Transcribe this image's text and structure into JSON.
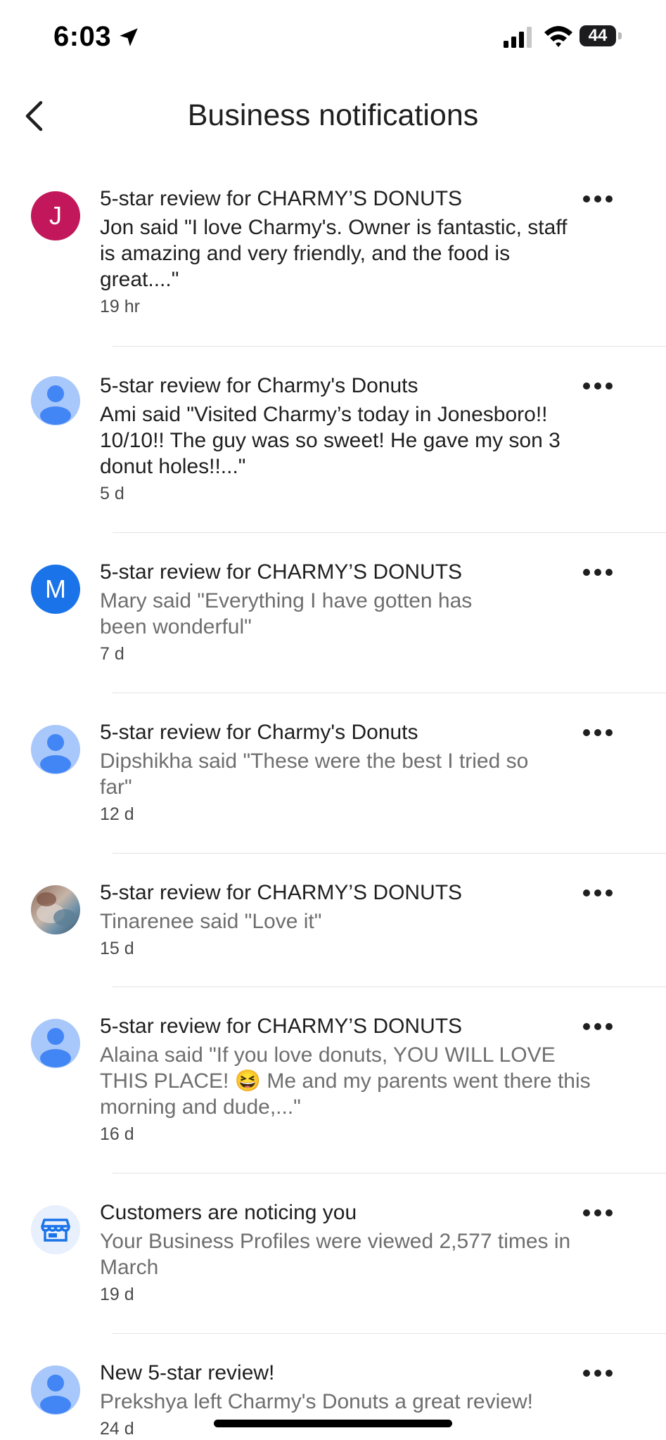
{
  "status_bar": {
    "time": "6:03",
    "battery": "44"
  },
  "header": {
    "title": "Business notifications",
    "back_icon": "chevron-left-icon"
  },
  "notifications": [
    {
      "avatar": "J",
      "avatar_color": "#c2185b",
      "title": "5-star review for CHARMY’S DONUTS",
      "body": "Jon said \"I love Charmy's. Owner is fantastic, staff is amazing and very friendly, and the food is great....\"",
      "time": "19 hr"
    },
    {
      "avatar_icon": "person-icon",
      "title": "5-star review for Charmy's Donuts",
      "body": "Ami said \"Visited Charmy’s today in Jonesboro!! 10/10!! The guy was so sweet! He gave my son 3 donut holes!!...\"",
      "time": "5 d"
    },
    {
      "avatar": "M",
      "avatar_color": "#1a73e8",
      "title": "5-star review for CHARMY’S DONUTS",
      "body": "Mary said \"Everything I have gotten has been wonderful\"",
      "time": "7 d"
    },
    {
      "avatar_icon": "person-icon",
      "title": "5-star review for Charmy's Donuts",
      "body": "Dipshikha said \"These were the best I tried so far\"",
      "time": "12 d"
    },
    {
      "avatar_icon": "profile-photo",
      "title": "5-star review for CHARMY’S DONUTS",
      "body": "Tinarenee said \"Love it\"",
      "time": "15 d"
    },
    {
      "avatar_icon": "person-icon",
      "title": "5-star review for CHARMY’S DONUTS",
      "body": "Alaina said \"If you love donuts, YOU WILL LOVE THIS PLACE! 😆 Me and my parents went there this morning and dude,...\"",
      "time": "16 d"
    },
    {
      "avatar_icon": "storefront-icon",
      "title": "Customers are noticing you",
      "body": "Your Business Profiles were viewed 2,577 times in March",
      "time": "19 d"
    },
    {
      "avatar_icon": "person-icon",
      "title": "New 5-star review!",
      "body": "Prekshya left Charmy's Donuts a great review!",
      "time": "24 d"
    }
  ],
  "colors": {
    "accent_person": "#a8c7fa",
    "person_fg": "#4285f4",
    "store_fg": "#1a73e8"
  }
}
